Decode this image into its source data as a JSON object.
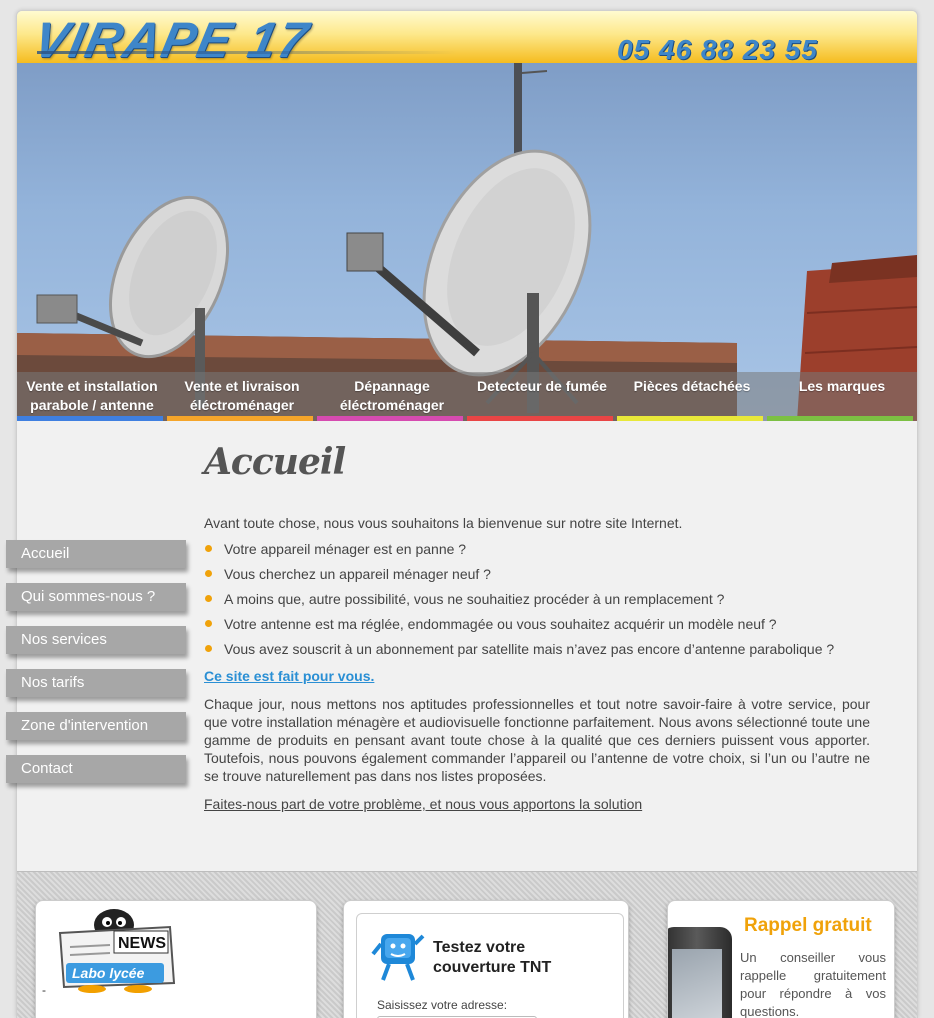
{
  "header": {
    "logo_text": "VIRAPE 17",
    "phone": "05 46 88 23 55"
  },
  "topnav": {
    "items": [
      {
        "label": "Vente et installation parabole / antenne",
        "color": "#3f7fe0"
      },
      {
        "label": "Vente et livraison éléctroménager",
        "color": "#f5a52a"
      },
      {
        "label": "Dépannage éléctroménager",
        "color": "#d64bb0"
      },
      {
        "label": "Detecteur de fumée",
        "color": "#e94545"
      },
      {
        "label": "Pièces détachées",
        "color": "#e8e83a"
      },
      {
        "label": "Les marques",
        "color": "#7cc043"
      }
    ]
  },
  "sidemenu": {
    "items": [
      "Accueil",
      "Qui sommes-nous ?",
      "Nos services",
      "Nos tarifs",
      "Zone d'intervention",
      "Contact"
    ]
  },
  "main": {
    "title": "Accueil",
    "intro": "Avant toute chose, nous vous souhaitons la bienvenue sur notre site Internet.",
    "bullets": [
      "Votre appareil ménager est en panne ?",
      "Vous cherchez un appareil ménager neuf ?",
      "A moins que, autre possibilité, vous ne souhaitiez procéder à un remplacement ?",
      "Votre antenne est ma réglée, endommagée ou vous souhaitez acquérir un modèle neuf ?",
      "Vous avez souscrit à un abonnement par satellite mais n’avez pas encore d’antenne parabolique ?"
    ],
    "callout": "Ce site est fait pour vous.",
    "paragraph": "Chaque jour, nous mettons nos aptitudes professionnelles et tout notre savoir-faire à votre service, pour que votre installation ménagère et audiovisuelle fonctionne parfaitement. Nous avons sélectionné toute une gamme de produits en pensant avant toute chose à la qualité que ces derniers puissent vous apporter. Toutefois, nous pouvons également commander l’appareil ou l’antenne de votre choix, si l’un ou l’autre ne se trouve naturellement pas dans nos listes proposées.",
    "cta": "Faites-nous part de votre problème, et nous vous apportons la solution"
  },
  "footer": {
    "news": {
      "logo_news": "NEWS",
      "logo_labo": "Labo lycée",
      "dash": "-"
    },
    "tnt": {
      "title": "Testez votre couverture TNT",
      "address_label": "Saisissez votre adresse:",
      "address_value": ""
    },
    "rappel": {
      "title": "Rappel gratuit",
      "text": "Un conseiller vous rappelle gratuitement pour répondre à vos questions."
    }
  },
  "colors": {
    "accent_orange": "#f0a20a",
    "link_blue": "#2a8fd4",
    "logo_blue": "#3e86c9",
    "side_menu_gray": "#a7a7a7"
  },
  "icons": [
    "satellite-banner-image",
    "news-penguin-icon",
    "tnt-mascot-icon",
    "phone-image"
  ]
}
